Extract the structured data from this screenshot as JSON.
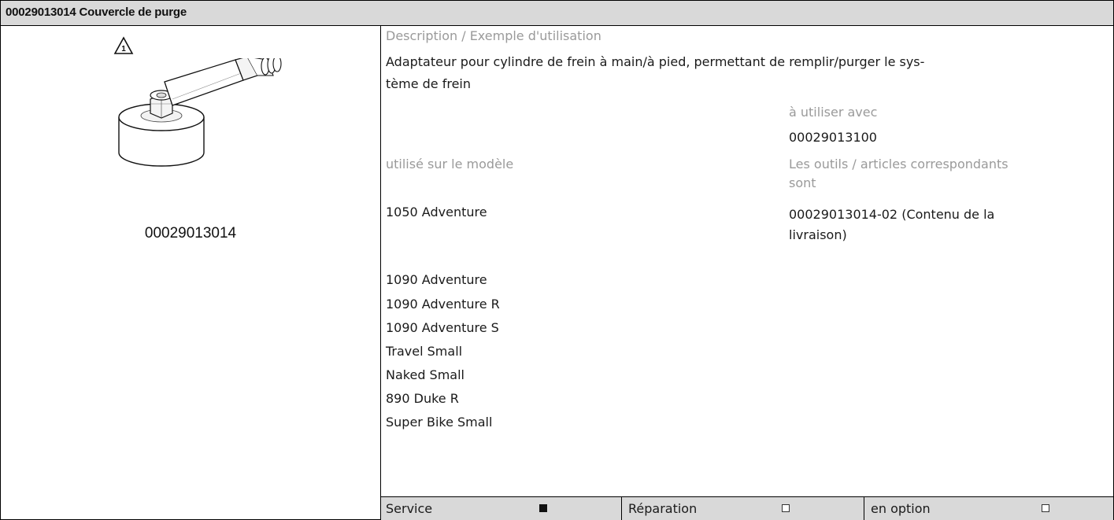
{
  "header": {
    "title": "00029013014 Couvercle de purge"
  },
  "left": {
    "part_number": "00029013014",
    "warning_number": "1"
  },
  "description": {
    "label": "Description / Exemple d'utilisation",
    "line1": "Adaptateur pour cylindre de frein à main/à pied, permettant de remplir/purger le sys-",
    "line2": "tème de frein"
  },
  "use_with": {
    "label": "à utiliser avec",
    "value": "00029013100"
  },
  "models": {
    "label": "utilisé sur le modèle",
    "items": [
      "1050 Adventure",
      "1090 Adventure",
      "1090 Adventure R",
      "1090 Adventure S",
      "Travel Small",
      "Naked Small",
      "890 Duke R",
      "Super Bike Small"
    ]
  },
  "related": {
    "label_line1": "Les outils / articles correspondants",
    "label_line2": "sont",
    "value_line1": "00029013014-02 (Contenu de la",
    "value_line2": "livraison)"
  },
  "checks": [
    {
      "label": "Service",
      "checked": true
    },
    {
      "label": "Réparation",
      "checked": false
    },
    {
      "label": "en option",
      "checked": false
    }
  ]
}
